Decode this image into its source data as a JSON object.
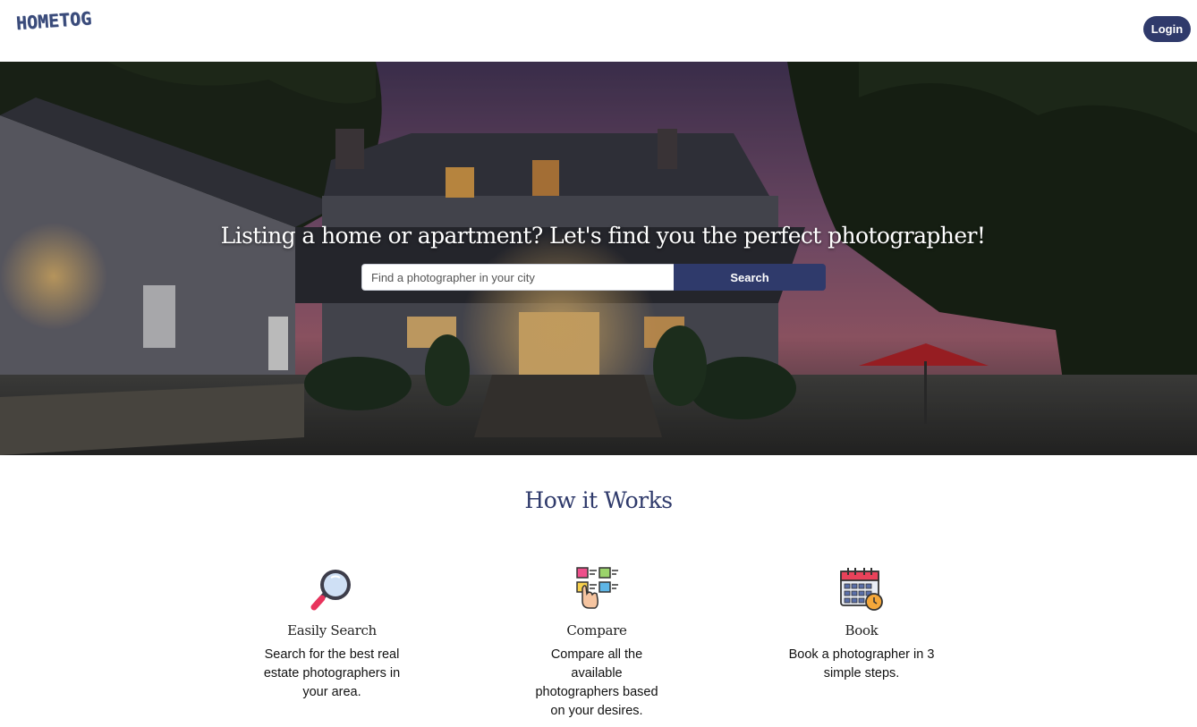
{
  "header": {
    "logo_text": "HOMETOG",
    "login_label": "Login"
  },
  "hero": {
    "headline": "Listing a home or apartment? Let's find you the perfect photographer!",
    "search_placeholder": "Find a photographer in your city",
    "search_button_label": "Search"
  },
  "how_it_works": {
    "title": "How it Works",
    "steps": [
      {
        "icon": "magnifier-icon",
        "title": "Easily Search",
        "description": "Search for the best real estate photographers in your area."
      },
      {
        "icon": "compare-cards-icon",
        "title": "Compare",
        "description": "Compare all the available photographers based on your desires."
      },
      {
        "icon": "calendar-clock-icon",
        "title": "Book",
        "description": "Book a photographer in 3 simple steps."
      }
    ]
  },
  "colors": {
    "brand_navy": "#2f3a6b",
    "white": "#ffffff"
  }
}
